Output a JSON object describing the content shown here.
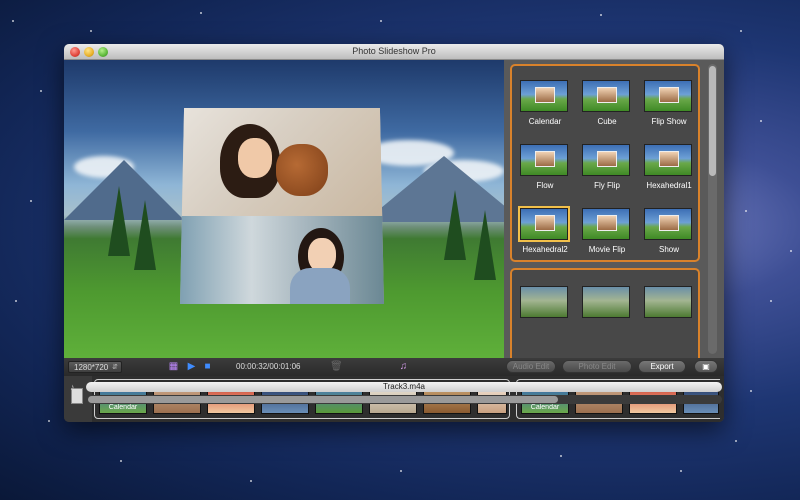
{
  "window": {
    "title": "Photo Slideshow Pro"
  },
  "effects": [
    {
      "label": "Calendar"
    },
    {
      "label": "Cube"
    },
    {
      "label": "Flip Show"
    },
    {
      "label": "Flow"
    },
    {
      "label": "Fly Flip"
    },
    {
      "label": "Hexahedral1"
    },
    {
      "label": "Hexahedral2",
      "selected": true
    },
    {
      "label": "Movie Flip"
    },
    {
      "label": "Show"
    }
  ],
  "controls": {
    "resolution": "1280*720",
    "time": "00:00:32/00:01:06",
    "audio_edit_label": "Audio Edit",
    "photo_edit_label": "Photo Edit",
    "export_label": "Export"
  },
  "timeline": {
    "clip_label": "Calendar",
    "clip_label_2": "Calendar",
    "audio_track": "Track3.m4a"
  },
  "colors": {
    "accent": "#d9822b",
    "selected": "#f2c04a"
  }
}
